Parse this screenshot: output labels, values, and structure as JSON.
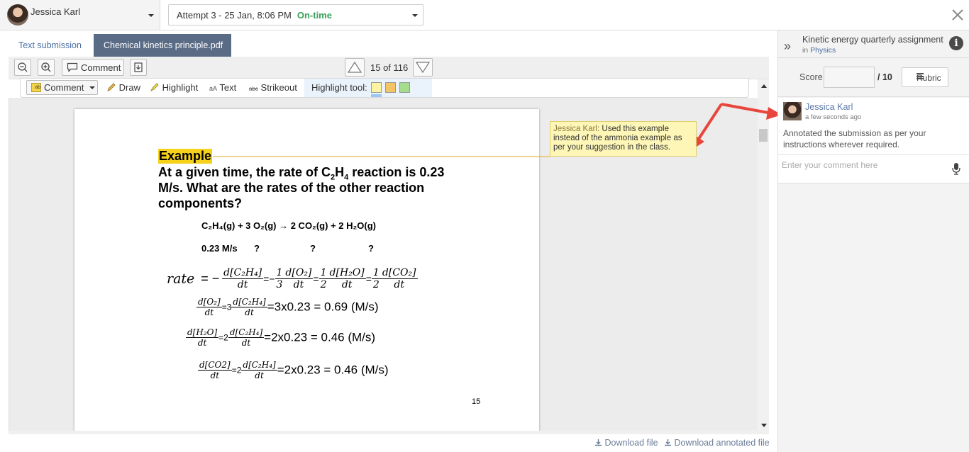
{
  "topbar": {
    "user_name": "Jessica Karl",
    "attempt_label": "Attempt 3 - 25 Jan, 8:06 PM",
    "attempt_status": "On-time"
  },
  "tabs": [
    "Text submission",
    "Chemical kinetics principle.pdf"
  ],
  "toolbar": {
    "comment_label": "Comment",
    "page_indicator": "15 of 116"
  },
  "annotation_toolbar": {
    "comment": "Comment",
    "draw": "Draw",
    "highlight": "Highlight",
    "text": "Text",
    "strikeout": "Strikeout",
    "highlight_tool": "Highlight tool:",
    "swatches": [
      "#fdf3a0",
      "#f5c465",
      "#a5dd8d"
    ],
    "icon_text_prefix": "aA",
    "icon_strike_prefix": "abc"
  },
  "document": {
    "heading": "Example",
    "question_line1_a": "At a given time, the rate of C",
    "question_line1_sub1": "2",
    "question_line1_b": "H",
    "question_line1_sub2": "4",
    "question_line1_c": " reaction is 0.23",
    "question_line2": "M/s.  What are the rates of the other reaction",
    "question_line3": "components?",
    "reaction": "C₂H₄(g) + 3 O₂(g) → 2 CO₂(g)  +  2 H₂O(g)",
    "rates_row": [
      "0.23 M/s",
      "?",
      "?",
      "?"
    ],
    "rate_word": "rate",
    "rate_eq": {
      "t1_num": "d[C₂H₄]",
      "t1_den": "dt",
      "t2_pre": "1",
      "t2_pre_den": "3",
      "t2_num": "d[O₂]",
      "t2_den": "dt",
      "t3_pre": "1",
      "t3_pre_den": "2",
      "t3_num": "d[H₂O]",
      "t3_den": "dt",
      "t4_pre": "1",
      "t4_pre_den": "2",
      "t4_num": "d[CO₂]",
      "t4_den": "dt"
    },
    "eq1": {
      "num": "d[O₂]",
      "den": "dt",
      "mid": "=3",
      "num2": "d[C₂H₄]",
      "den2": "dt",
      "result": "=3x0.23 = 0.69 (M/s)"
    },
    "eq2": {
      "num": "d[H₂O]",
      "den": "dt",
      "mid": "=2",
      "num2": "d[C₂H₄]",
      "den2": "dt",
      "result": "=2x0.23 = 0.46 (M/s)"
    },
    "eq3": {
      "num": "d[CO2]",
      "den": "dt",
      "mid": "=2",
      "num2": "d[C₂H₄]",
      "den2": "dt",
      "result": "=2x0.23 = 0.46 (M/s)"
    },
    "page_number": "15"
  },
  "annotation_note": {
    "author": "Jessica Karl:",
    "text": " Used this example instead of the ammonia example as per your suggestion in the class."
  },
  "downloads": {
    "file": "Download file",
    "annotated": "Download annotated file"
  },
  "right_panel": {
    "title": "Kinetic energy quarterly assignment",
    "course_prefix": "in",
    "course": "Physics",
    "score_label": "Score",
    "score_value": "",
    "score_max": "/ 10",
    "rubric_label": "Rubric",
    "comment": {
      "author": "Jessica Karl",
      "time": "a few seconds ago",
      "text": "Annotated the submission as per your instructions wherever required."
    },
    "comment_placeholder": "Enter your comment here"
  },
  "colors": {
    "accent_tab": "#5a6b86",
    "on_time": "#3aa05a",
    "link": "#4a6fa5",
    "highlight": "#f7d21b",
    "arrow": "#e8463c",
    "note_bg": "#fdf6b6"
  }
}
